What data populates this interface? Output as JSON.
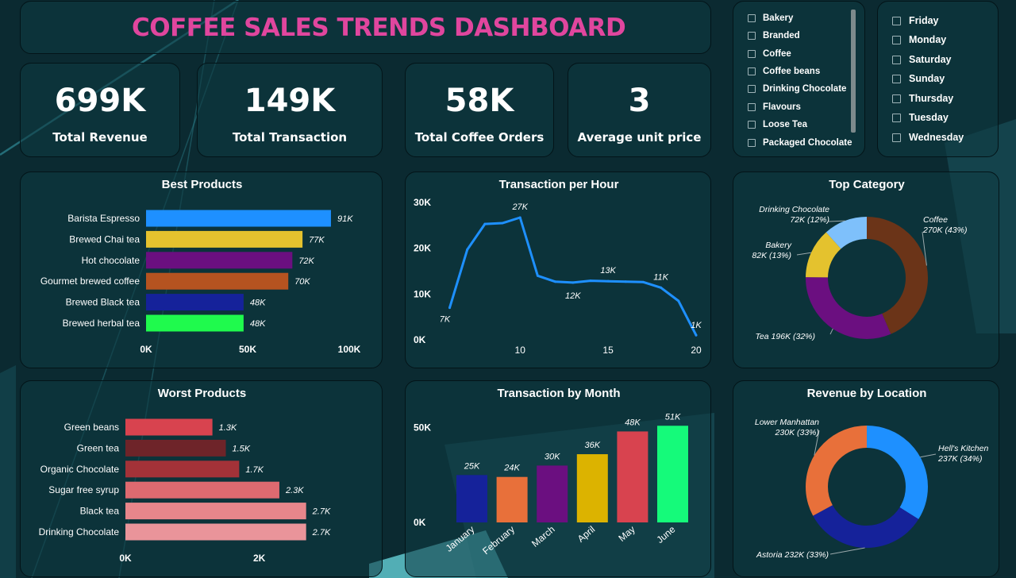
{
  "dashboard": {
    "title": "COFFEE SALES TRENDS DASHBOARD"
  },
  "kpis": [
    {
      "value": "699K",
      "label": "Total Revenue"
    },
    {
      "value": "149K",
      "label": "Total Transaction"
    },
    {
      "value": "58K",
      "label": "Total Coffee Orders"
    },
    {
      "value": "3",
      "label": "Average unit price"
    }
  ],
  "slicers": {
    "categories": [
      "Bakery",
      "Branded",
      "Coffee",
      "Coffee beans",
      "Drinking Chocolate",
      "Flavours",
      "Loose Tea",
      "Packaged Chocolate"
    ],
    "days": [
      "Friday",
      "Monday",
      "Saturday",
      "Sunday",
      "Thursday",
      "Tuesday",
      "Wednesday"
    ]
  },
  "colors": {
    "title": "#e0469e",
    "background": "#0b2a31",
    "line": "#1e90ff"
  },
  "chart_data": [
    {
      "id": "best",
      "type": "bar",
      "orientation": "horizontal",
      "title": "Best Products",
      "categories": [
        "Barista Espresso",
        "Brewed Chai tea",
        "Hot chocolate",
        "Gourmet brewed coffee",
        "Brewed Black tea",
        "Brewed herbal tea"
      ],
      "values": [
        91,
        77,
        72,
        70,
        48,
        48
      ],
      "labels": [
        "91K",
        "77K",
        "72K",
        "70K",
        "48K",
        "48K"
      ],
      "colors": [
        "#1e90ff",
        "#e4c22e",
        "#6b0f80",
        "#b55320",
        "#15229a",
        "#1ffa4d"
      ],
      "xlim": [
        0,
        100
      ],
      "ticks": [
        0,
        50,
        100
      ],
      "tick_labels": [
        "0K",
        "50K",
        "100K"
      ]
    },
    {
      "id": "hour",
      "type": "line",
      "title": "Transaction per Hour",
      "x": [
        6,
        7,
        8,
        9,
        10,
        11,
        12,
        13,
        14,
        15,
        16,
        17,
        18,
        19,
        20
      ],
      "values": [
        7,
        19.7,
        25.3,
        25.5,
        26.7,
        14,
        12.7,
        12.5,
        12.9,
        12.8,
        12.7,
        12.6,
        11.4,
        8.5,
        1
      ],
      "labels": [
        {
          "index": 0,
          "text": "7K"
        },
        {
          "index": 4,
          "text": "27K"
        },
        {
          "index": 7,
          "text": "12K"
        },
        {
          "index": 9,
          "text": "13K"
        },
        {
          "index": 12,
          "text": "11K"
        },
        {
          "index": 14,
          "text": "1K"
        }
      ],
      "ylim": [
        0,
        30
      ],
      "yticks": [
        0,
        10,
        20,
        30
      ],
      "ytick_labels": [
        "0K",
        "10K",
        "20K",
        "30K"
      ],
      "xlim": [
        5.3,
        20
      ],
      "xticks": [
        10,
        15,
        20
      ],
      "xtick_labels": [
        "10",
        "15",
        "20"
      ]
    },
    {
      "id": "category",
      "type": "pie",
      "donut": true,
      "title": "Top Category",
      "slices": [
        {
          "name": "Coffee",
          "value": 270,
          "label": "270K (43%)",
          "color": "#6b3418"
        },
        {
          "name": "Tea",
          "value": 196,
          "label": "196K (32%)",
          "color": "#6b0f80"
        },
        {
          "name": "Bakery",
          "value": 82,
          "label": "82K (13%)",
          "color": "#e4c22e"
        },
        {
          "name": "Drinking Chocolate",
          "value": 72,
          "label": "72K (12%)",
          "color": "#7ec0fb"
        }
      ]
    },
    {
      "id": "worst",
      "type": "bar",
      "orientation": "horizontal",
      "title": "Worst Products",
      "categories": [
        "Green beans",
        "Green tea",
        "Organic Chocolate",
        "Sugar free syrup",
        "Black tea",
        "Drinking Chocolate"
      ],
      "values": [
        1.3,
        1.5,
        1.7,
        2.3,
        2.7,
        2.7
      ],
      "labels": [
        "1.3K",
        "1.5K",
        "1.7K",
        "2.3K",
        "2.7K",
        "2.7K"
      ],
      "colors": [
        "#d8434f",
        "#6e2429",
        "#a33238",
        "#dd6a70",
        "#e7868b",
        "#e9949a"
      ],
      "xlim": [
        0,
        3.7
      ],
      "ticks": [
        0,
        2
      ],
      "tick_labels": [
        "0K",
        "2K"
      ]
    },
    {
      "id": "month",
      "type": "bar",
      "title": "Transaction by Month",
      "categories": [
        "January",
        "February",
        "March",
        "April",
        "May",
        "June"
      ],
      "values": [
        25,
        24,
        30,
        36,
        48,
        51
      ],
      "labels": [
        "25K",
        "24K",
        "30K",
        "36K",
        "48K",
        "51K"
      ],
      "colors": [
        "#15229a",
        "#e8703a",
        "#6b0f80",
        "#dcb300",
        "#d8434f",
        "#15fa7a"
      ],
      "ylim": [
        0,
        62
      ],
      "yticks": [
        0,
        50
      ],
      "ytick_labels": [
        "0K",
        "50K"
      ]
    },
    {
      "id": "location",
      "type": "pie",
      "donut": true,
      "title": "Revenue by Location",
      "slices": [
        {
          "name": "Hell's Kitchen",
          "value": 237,
          "label": "237K (34%)",
          "color": "#1e90ff"
        },
        {
          "name": "Astoria",
          "value": 232,
          "label": "232K (33%)",
          "color": "#15229a"
        },
        {
          "name": "Lower Manhattan",
          "value": 230,
          "label": "230K (33%)",
          "color": "#e8703a"
        }
      ]
    }
  ]
}
